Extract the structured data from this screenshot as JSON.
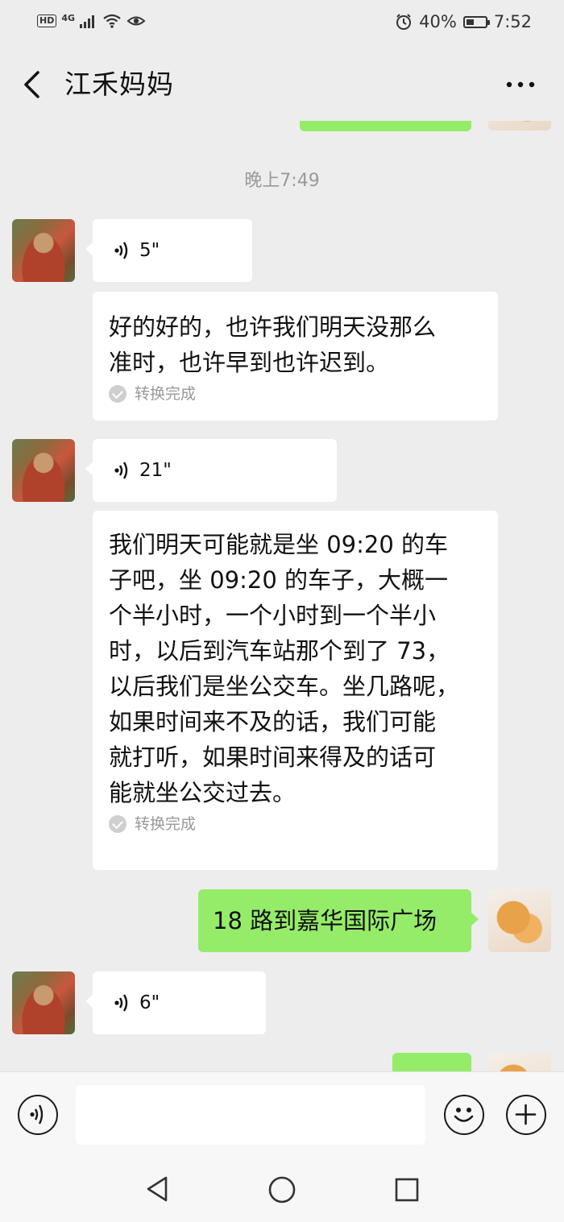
{
  "status_bar": {
    "network_badge": "HD",
    "network_type": "4G",
    "battery_percent": 40,
    "battery_label": "40%",
    "time": "7:52"
  },
  "header": {
    "title": "江禾妈妈",
    "back_icon": "chevron-left-icon",
    "more_icon": "more-dots-icon"
  },
  "chat": {
    "timestamp": "晚上7:49",
    "messages": [
      {
        "sender": "contact",
        "type": "voice",
        "duration": "5\""
      },
      {
        "sender": "contact",
        "type": "transcript",
        "lines": [
          "好的好的，也许我们明天没那么",
          "准时，也许早到也许迟到。"
        ],
        "status": "转换完成"
      },
      {
        "sender": "contact",
        "type": "voice",
        "duration": "21\""
      },
      {
        "sender": "contact",
        "type": "transcript",
        "lines": [
          "我们明天可能就是坐 09:20 的车",
          "子吧，坐 09:20 的车子，大概一",
          "个半小时，一个小时到一个半小",
          "时，以后到汽车站那个到了 73，",
          "以后我们是坐公交车。坐几路呢，",
          "如果时间来不及的话，我们可能",
          "就打听，如果时间来得及的话可",
          "能就坐公交过去。"
        ],
        "status": "转换完成"
      },
      {
        "sender": "me",
        "type": "text",
        "text": "18 路到嘉华国际广场"
      },
      {
        "sender": "contact",
        "type": "voice",
        "duration": "6\""
      }
    ]
  },
  "colors": {
    "background": "#ededed",
    "my_bubble": "#95ec69",
    "their_bubble": "#ffffff"
  },
  "input_bar": {
    "voice_icon": "voice-mode-icon",
    "emoji_icon": "emoji-icon",
    "plus_icon": "plus-icon",
    "text_value": ""
  },
  "nav_bar": {
    "back_icon": "nav-back-icon",
    "home_icon": "nav-home-icon",
    "recents_icon": "nav-recents-icon"
  }
}
